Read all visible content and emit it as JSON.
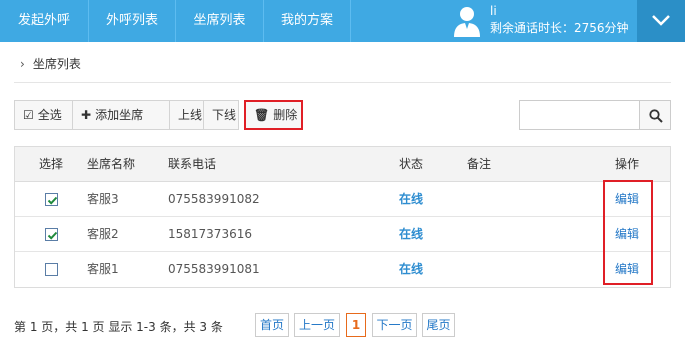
{
  "nav": {
    "items": [
      {
        "label": "发起外呼"
      },
      {
        "label": "外呼列表"
      },
      {
        "label": "坐席列表"
      },
      {
        "label": "我的方案"
      }
    ]
  },
  "user": {
    "name": "li",
    "remaining_time": "剩余通话时长：2756分钟",
    "avatar_icon": "user-avatar-icon",
    "menu_icon": "chevron-down-icon"
  },
  "breadcrumb": {
    "label": "坐席列表"
  },
  "toolbar": {
    "select_all": "全选",
    "add_agent": "添加坐席",
    "online": "上线",
    "offline": "下线",
    "delete": "删除"
  },
  "search": {
    "value": "",
    "placeholder": ""
  },
  "table": {
    "headers": {
      "select": "选择",
      "name": "坐席名称",
      "phone": "联系电话",
      "status": "状态",
      "note": "备注",
      "action": "操作"
    },
    "rows": [
      {
        "checked": true,
        "name": "客服3",
        "phone": "075583991082",
        "status": "在线",
        "note": "",
        "action": "编辑"
      },
      {
        "checked": true,
        "name": "客服2",
        "phone": "15817373616",
        "status": "在线",
        "note": "",
        "action": "编辑"
      },
      {
        "checked": false,
        "name": "客服1",
        "phone": "075583991081",
        "status": "在线",
        "note": "",
        "action": "编辑"
      }
    ]
  },
  "pagination": {
    "info": "第 1 页，共 1 页 显示 1-3 条，共 3 条",
    "first": "首页",
    "prev": "上一页",
    "current": "1",
    "next": "下一页",
    "last": "尾页"
  },
  "colors": {
    "nav_bg": "#3fa9e3",
    "highlight_red": "#e01f26",
    "link_blue": "#2478c7",
    "current_page_orange": "#e76a1b"
  }
}
